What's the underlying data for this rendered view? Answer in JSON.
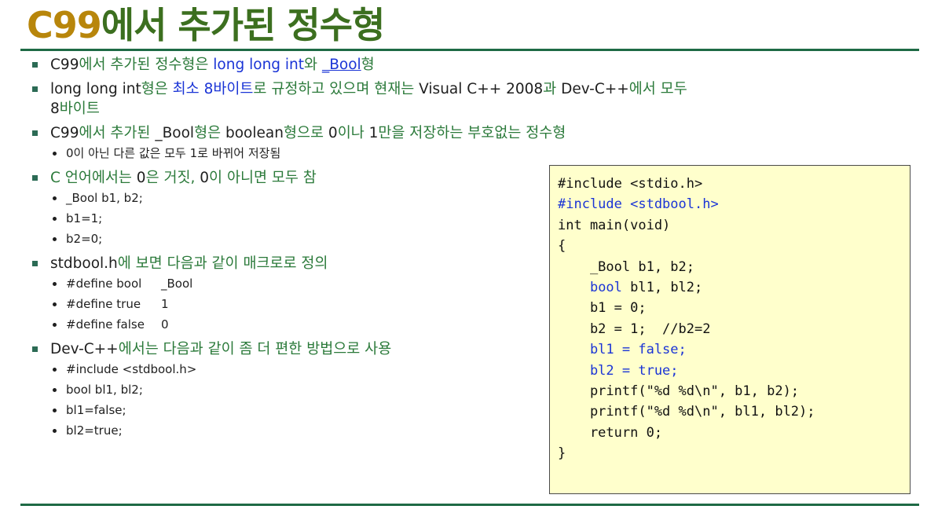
{
  "title": {
    "prefix": "C99",
    "rest": "에서 추가된 정수형"
  },
  "bullets": [
    {
      "parts": [
        {
          "t": "C99",
          "c": "bk"
        },
        {
          "t": "에서 추가된 정수형은 ",
          "c": "gr"
        },
        {
          "t": "long long int",
          "c": "blue"
        },
        {
          "t": "와 ",
          "c": "gr"
        },
        {
          "t": "_Bool",
          "c": "blue ul"
        },
        {
          "t": "형",
          "c": "gr"
        }
      ]
    },
    {
      "parts": [
        {
          "t": "long long int",
          "c": "bk"
        },
        {
          "t": "형은 ",
          "c": "gr"
        },
        {
          "t": "최소 8바이트",
          "c": "blue"
        },
        {
          "t": "로 규정하고 있으며 현재는 ",
          "c": "gr"
        },
        {
          "t": "Visual C++ 2008",
          "c": "bk"
        },
        {
          "t": "과 ",
          "c": "gr"
        },
        {
          "t": "Dev-C++",
          "c": "bk"
        },
        {
          "t": "에서 모두 ",
          "c": "gr"
        }
      ],
      "line2": [
        {
          "t": "8",
          "c": "bk"
        },
        {
          "t": "바이트",
          "c": "gr"
        }
      ]
    },
    {
      "parts": [
        {
          "t": "C99",
          "c": "bk"
        },
        {
          "t": "에서 추가된 ",
          "c": "gr"
        },
        {
          "t": "_Bool",
          "c": "bk"
        },
        {
          "t": "형은 ",
          "c": "gr"
        },
        {
          "t": "boolean",
          "c": "bk"
        },
        {
          "t": "형으로 ",
          "c": "gr"
        },
        {
          "t": "0",
          "c": "bk"
        },
        {
          "t": "이나 ",
          "c": "gr"
        },
        {
          "t": "1",
          "c": "bk"
        },
        {
          "t": "만을 저장하는 부호없는 정수형",
          "c": "gr"
        }
      ],
      "sub": [
        "0이 아닌 다른 값은 모두 1로 바뀌어 저장됨"
      ]
    },
    {
      "parts": [
        {
          "t": "C 언어에서는 ",
          "c": "gr"
        },
        {
          "t": "0",
          "c": "bk"
        },
        {
          "t": "은 거짓, ",
          "c": "gr"
        },
        {
          "t": "0",
          "c": "bk"
        },
        {
          "t": "이 아니면 모두 참",
          "c": "gr"
        }
      ],
      "sub": [
        "_Bool b1, b2;",
        "b1=1;",
        "b2=0;"
      ]
    },
    {
      "parts": [
        {
          "t": "stdbool.h",
          "c": "bk"
        },
        {
          "t": "에 보면 다음과 같이 매크로로 정의",
          "c": "gr"
        }
      ],
      "sub_tab": [
        {
          "a": "#define bool",
          "b": "_Bool"
        },
        {
          "a": "#define true",
          "b": "1"
        },
        {
          "a": "#define false",
          "b": "0"
        }
      ]
    },
    {
      "parts": [
        {
          "t": "Dev-C++",
          "c": "bk"
        },
        {
          "t": "에서는 다음과 같이 좀 더 편한 방법으로 사용",
          "c": "gr"
        }
      ],
      "sub": [
        "#include <stdbool.h>",
        "bool bl1, bl2;",
        "bl1=false;",
        "bl2=true;"
      ]
    }
  ],
  "code": [
    {
      "t": "#include <stdio.h>",
      "hl": false
    },
    {
      "t": "#include <stdbool.h>",
      "hl": true
    },
    {
      "t": "int main(void)",
      "hl": false
    },
    {
      "t": "{",
      "hl": false
    },
    {
      "t": "    _Bool b1, b2;",
      "hl": false
    },
    {
      "t": "    bool bl1, bl2;",
      "hl": "part",
      "pre": "    ",
      "blue": "bool",
      "post": " bl1, bl2;"
    },
    {
      "t": "    b1 = 0;",
      "hl": false
    },
    {
      "t": "    b2 = 1;  //b2=2",
      "hl": false
    },
    {
      "t": "    bl1 = false;",
      "hl": true
    },
    {
      "t": "    bl2 = true;",
      "hl": true
    },
    {
      "t": "    printf(\"%d %d\\n\", b1, b2);",
      "hl": false
    },
    {
      "t": "    printf(\"%d %d\\n\", bl1, bl2);",
      "hl": false
    },
    {
      "t": "    return 0;",
      "hl": false
    },
    {
      "t": "}",
      "hl": false
    }
  ],
  "colors": {
    "title": "#3c6f1f",
    "accent": "#b8860b",
    "rule": "#1e6a45",
    "link": "#1a34d6",
    "code_bg": "#ffffcc"
  }
}
